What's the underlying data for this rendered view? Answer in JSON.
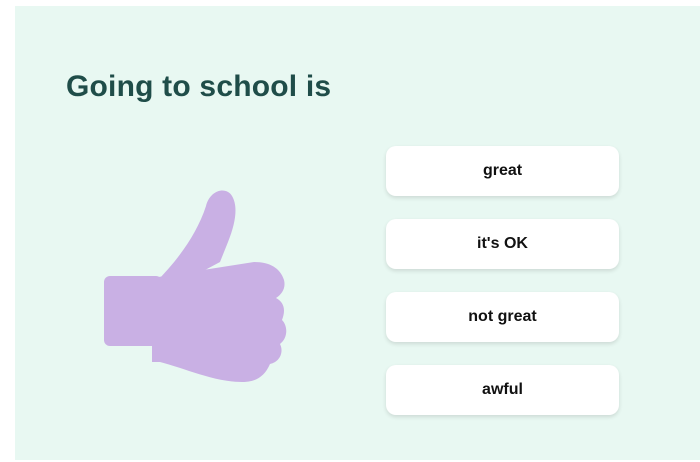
{
  "question": {
    "text": "Going to school is"
  },
  "illustration": {
    "icon": "thumbs-up-icon",
    "color": "#c9b0e4"
  },
  "options": [
    {
      "label": "great"
    },
    {
      "label": "it's OK"
    },
    {
      "label": "not great"
    },
    {
      "label": "awful"
    }
  ],
  "colors": {
    "background": "#e8f8f2",
    "title": "#1f4d49",
    "button": "#ffffff"
  }
}
